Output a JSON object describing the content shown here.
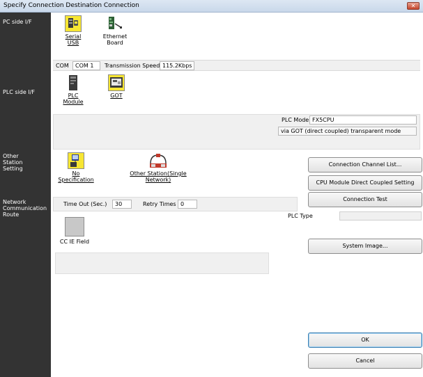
{
  "window": {
    "title": "Specify Connection Destination Connection",
    "close_glyph": "✕"
  },
  "sidebar": {
    "pc_side": "PC side I/F",
    "plc_side": "PLC side I/F",
    "other_station": "Other\nStation\nSetting",
    "network_route": "Network\nCommunication\nRoute"
  },
  "pc_side": {
    "serial_usb": {
      "line1": "Serial",
      "line2": "USB"
    },
    "ethernet_board": {
      "line1": "Ethernet",
      "line2": "Board"
    },
    "com_label": "COM",
    "com_value": "COM 1",
    "speed_label": "Transmission Speed",
    "speed_value": "115.2Kbps"
  },
  "plc_side": {
    "plc_module": {
      "line1": "PLC",
      "line2": "Module"
    },
    "got": "GOT",
    "mode_label": "PLC Mode",
    "mode_value": "FX5CPU",
    "transparent_mode": "via GOT (direct coupled) transparent mode"
  },
  "other_station": {
    "no_spec": "No Specification",
    "other_single": {
      "line1": "Other Station(Single",
      "line2": "Network)"
    },
    "timeout_label": "Time Out (Sec.)",
    "timeout_value": "30",
    "retry_label": "Retry Times",
    "retry_value": "0"
  },
  "network_route": {
    "cc_ie_field": "CC IE Field"
  },
  "buttons": {
    "channel_list": "Connection Channel List...",
    "cpu_direct": "CPU Module Direct Coupled Setting",
    "connection_test": "Connection Test",
    "system_image": "System Image...",
    "ok": "OK",
    "cancel": "Cancel"
  },
  "plc_type": {
    "label": "PLC Type",
    "value": ""
  }
}
